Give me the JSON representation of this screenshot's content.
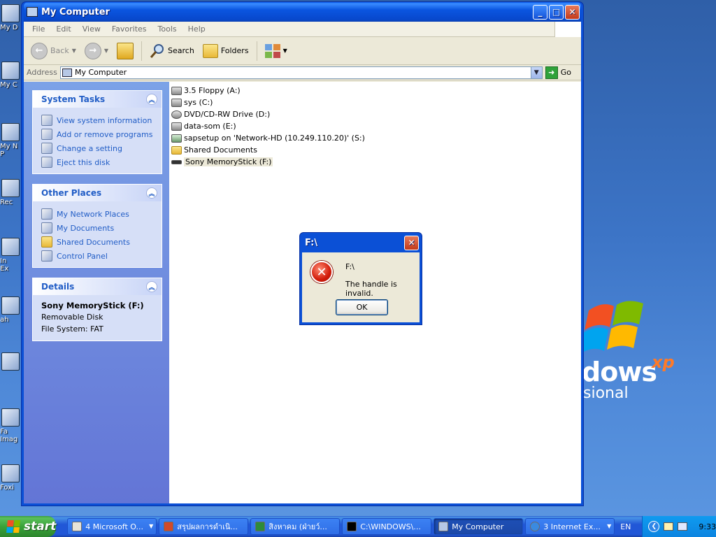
{
  "desktop": {
    "icons": [
      {
        "label": "My D"
      },
      {
        "label": "My C"
      },
      {
        "label": "My N\nP"
      },
      {
        "label": "Rec"
      },
      {
        "label": "In\nEx"
      },
      {
        "label": "ah"
      },
      {
        "label": ""
      },
      {
        "label": "Fa\nImag"
      },
      {
        "label": "Foxi"
      }
    ],
    "logo_word": "dows",
    "logo_sup": "xp",
    "logo_edition": "sional"
  },
  "window": {
    "title": "My Computer",
    "min_symbol": "_",
    "max_symbol": "□",
    "close_symbol": "✕",
    "menu": [
      "File",
      "Edit",
      "View",
      "Favorites",
      "Tools",
      "Help"
    ],
    "toolbar": {
      "back_label": "Back",
      "search_label": "Search",
      "folders_label": "Folders"
    },
    "address": {
      "label": "Address",
      "value": "My Computer",
      "go_label": "Go"
    }
  },
  "left_pane": {
    "system_tasks": {
      "title": "System Tasks",
      "items": [
        "View system information",
        "Add or remove programs",
        "Change a setting",
        "Eject this disk"
      ]
    },
    "other_places": {
      "title": "Other Places",
      "items": [
        "My Network Places",
        "My Documents",
        "Shared Documents",
        "Control Panel"
      ]
    },
    "details": {
      "title": "Details",
      "name": "Sony MemoryStick (F:)",
      "type": "Removable Disk",
      "filesystem": "File System: FAT"
    }
  },
  "files": [
    {
      "label": "3.5 Floppy (A:)",
      "icon": "floppy-drive-icon"
    },
    {
      "label": "sys (C:)",
      "icon": "hard-disk-icon"
    },
    {
      "label": "DVD/CD-RW Drive (D:)",
      "icon": "cd-drive-icon"
    },
    {
      "label": "data-som (E:)",
      "icon": "hard-disk-icon"
    },
    {
      "label": "sapsetup on 'Network-HD (10.249.110.20)' (S:)",
      "icon": "network-drive-icon"
    },
    {
      "label": "Shared Documents",
      "icon": "folder-icon"
    },
    {
      "label": "Sony MemoryStick (F:)",
      "icon": "removable-disk-icon"
    }
  ],
  "dialog": {
    "title": "F:\\",
    "path": "F:\\",
    "message": "The handle is invalid.",
    "ok_label": "OK"
  },
  "taskbar": {
    "start_label": "start",
    "tasks": [
      {
        "label": "4 Microsoft O...",
        "group": true,
        "active": false
      },
      {
        "label": "สรุปผลการดำเนิ...",
        "group": false,
        "active": false
      },
      {
        "label": "สิงหาคม (ฝ่ายว์...",
        "group": false,
        "active": false
      },
      {
        "label": "C:\\WINDOWS\\...",
        "group": false,
        "active": false
      },
      {
        "label": "My Computer",
        "group": false,
        "active": true
      },
      {
        "label": "3 Internet Ex...",
        "group": true,
        "active": false
      }
    ],
    "language": "EN",
    "clock": "9:33"
  }
}
